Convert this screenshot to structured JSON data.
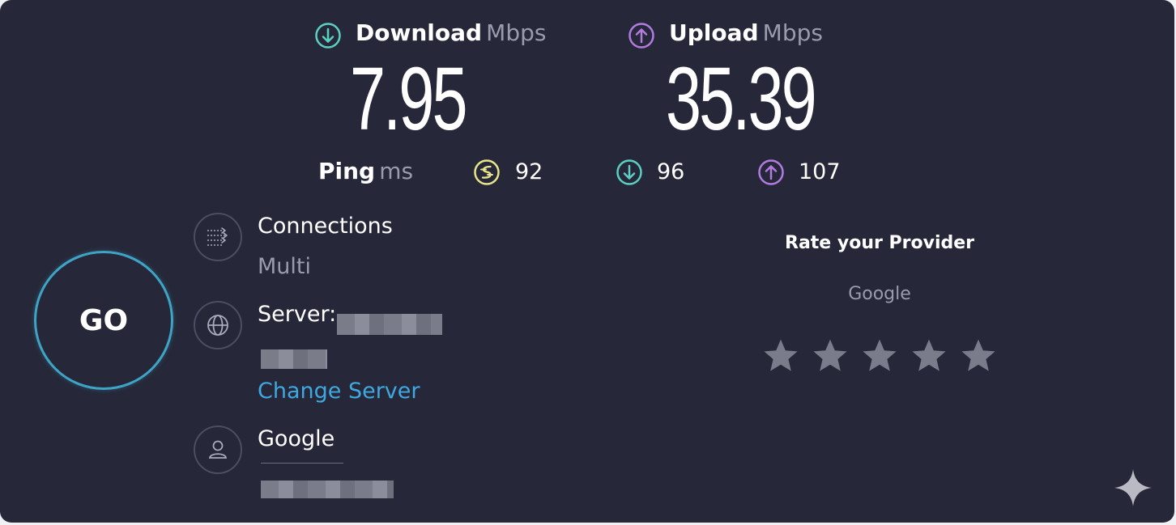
{
  "download": {
    "label": "Download",
    "unit": "Mbps",
    "value": "7.95",
    "icon": "arrow-down-circle-icon",
    "color": "#5bd0c1"
  },
  "upload": {
    "label": "Upload",
    "unit": "Mbps",
    "value": "35.39",
    "icon": "arrow-up-circle-icon",
    "color": "#b27be0"
  },
  "ping": {
    "label": "Ping",
    "unit": "ms",
    "idle": "92",
    "download": "96",
    "upload": "107",
    "idle_color": "#e8e58a",
    "download_color": "#5bd0c1",
    "upload_color": "#b27be0"
  },
  "go_button": {
    "label": "GO",
    "color": "#3ea4c6"
  },
  "connections": {
    "title": "Connections",
    "value": "Multi",
    "icon": "connections-arrows-icon"
  },
  "server": {
    "title": "Server:",
    "change_label": "Change Server",
    "icon": "globe-icon"
  },
  "provider": {
    "name": "Google",
    "icon": "user-icon"
  },
  "rating": {
    "title": "Rate your Provider",
    "provider": "Google",
    "stars": 5,
    "rating": 0
  },
  "colors": {
    "background": "#262839",
    "link": "#3fa8e0",
    "muted": "#9a9cad"
  }
}
